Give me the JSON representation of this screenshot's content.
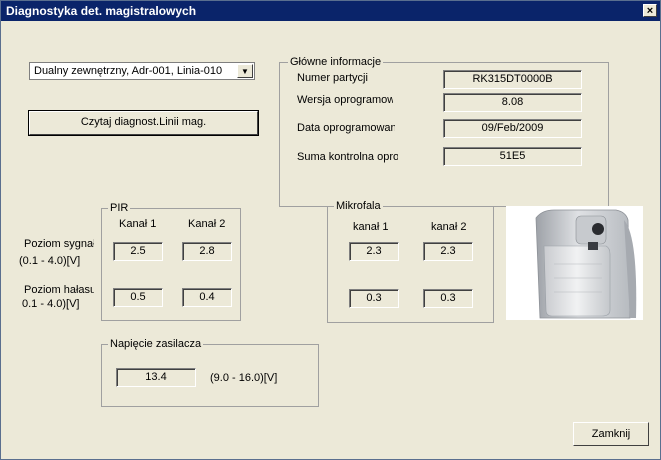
{
  "window": {
    "title": "Diagnostyka det. magistralowych",
    "close_glyph": "×"
  },
  "detector_select": {
    "value": "Dualny zewnętrzny, Adr-001, Linia-010"
  },
  "read_button": {
    "label": "Czytaj diagnost.Linii mag."
  },
  "main_info": {
    "title": "Główne informacje",
    "rows": [
      {
        "label": "Numer partycji",
        "value": "RK315DT0000B"
      },
      {
        "label": "Wersja oprogramow",
        "value": "8.08"
      },
      {
        "label": "Data oprogramowan",
        "value": "09/Feb/2009"
      },
      {
        "label": "Suma kontrolna opro",
        "value": "51E5"
      }
    ]
  },
  "row_labels": {
    "signal": "Poziom sygnał",
    "signal_range": "(0.1 - 4.0)[V]",
    "noise": "Poziom hałasu",
    "noise_range": "0.1 - 4.0)[V]"
  },
  "pir": {
    "title": "PIR",
    "ch1_label": "Kanał 1",
    "ch2_label": "Kanał 2",
    "signal_ch1": "2.5",
    "signal_ch2": "2.8",
    "noise_ch1": "0.5",
    "noise_ch2": "0.4"
  },
  "microwave": {
    "title": "Mikrofala",
    "ch1_label": "kanał 1",
    "ch2_label": "kanał 2",
    "signal_ch1": "2.3",
    "signal_ch2": "2.3",
    "noise_ch1": "0.3",
    "noise_ch2": "0.3"
  },
  "supply": {
    "title": "Napięcie zasilacza",
    "value": "13.4",
    "range": "(9.0 - 16.0)[V]"
  },
  "close_button": {
    "label": "Zamknij"
  }
}
